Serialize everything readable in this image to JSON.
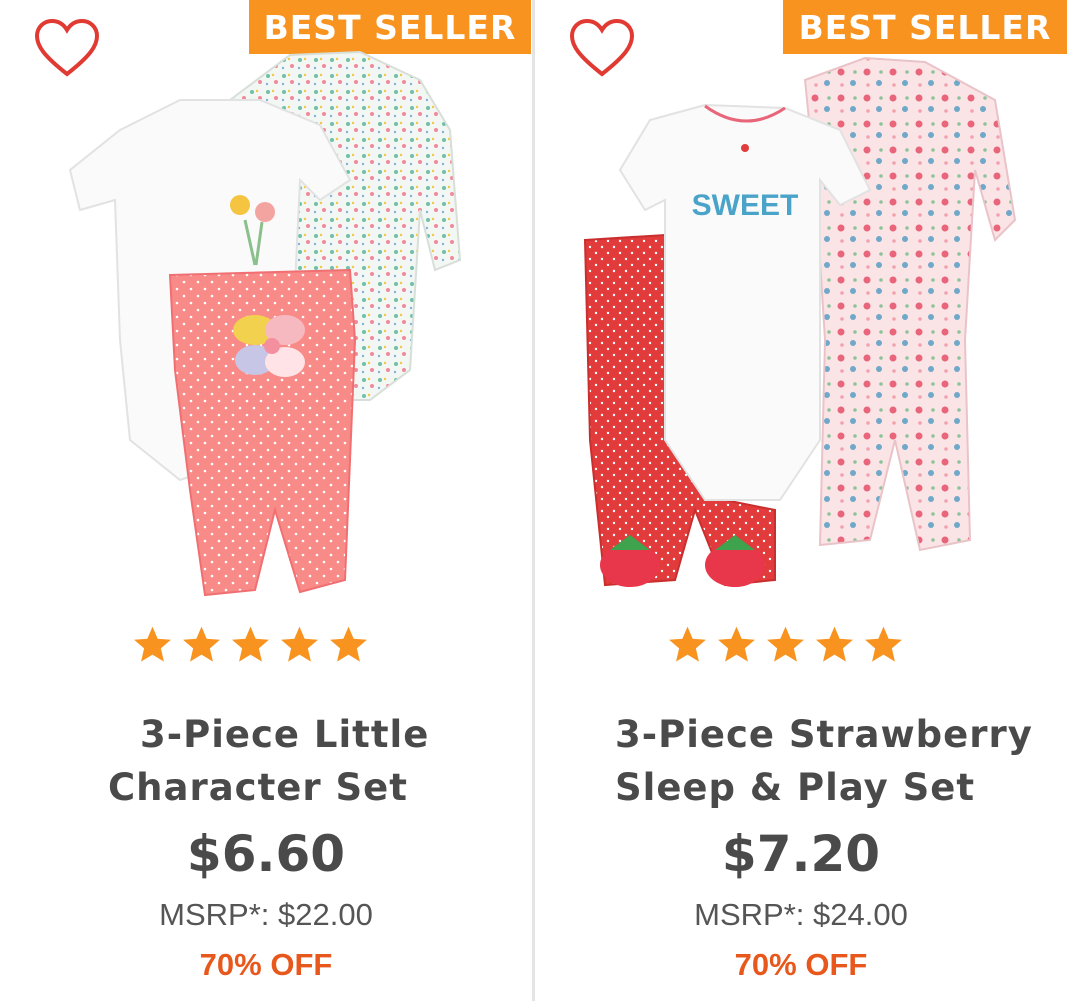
{
  "colors": {
    "badge": "#f7931e",
    "star": "#f7931e",
    "heart": "#e03a32",
    "discount": "#e8581c",
    "text": "#4a4a4a"
  },
  "products": [
    {
      "badge": "BEST SELLER",
      "rating": 5,
      "title_line1": "3-Piece Little",
      "title_line2": "Character Set",
      "price": "$6.60",
      "msrp": "MSRP*: $22.00",
      "discount": "70% OFF"
    },
    {
      "badge": "BEST SELLER",
      "rating": 5,
      "title_line1": "3-Piece Strawberry",
      "title_line2": "Sleep & Play Set",
      "price": "$7.20",
      "msrp": "MSRP*: $24.00",
      "discount": "70% OFF"
    }
  ]
}
